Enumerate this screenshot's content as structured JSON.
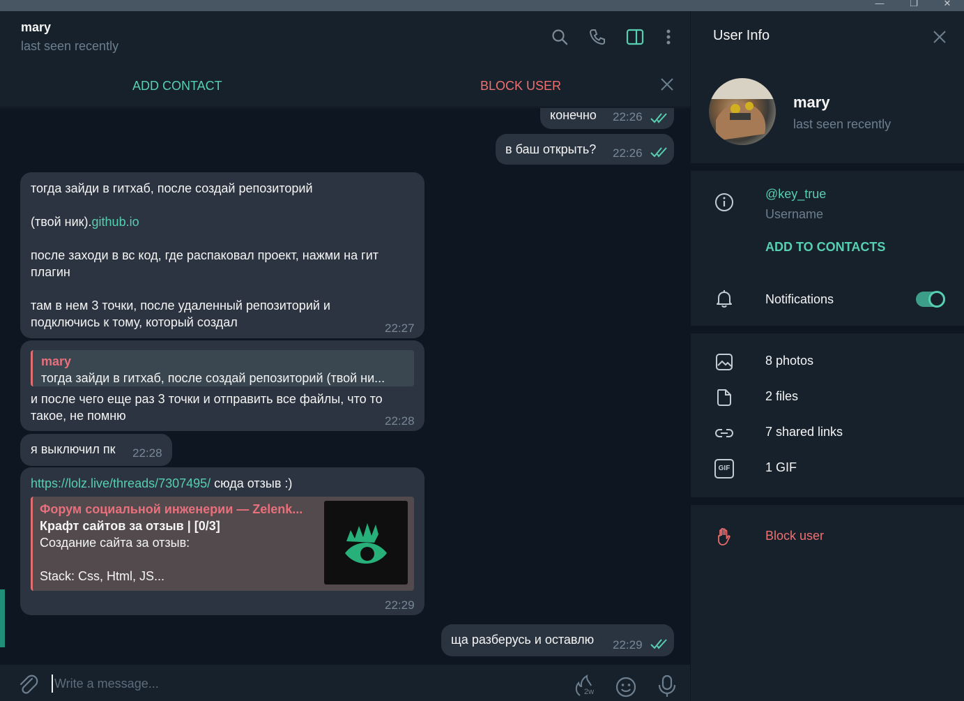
{
  "window": {
    "minimize_glyph": "—",
    "maximize_glyph": "❐",
    "close_glyph": "✕"
  },
  "header": {
    "name": "mary",
    "status": "last seen recently"
  },
  "action_bar": {
    "add_contact": "ADD CONTACT",
    "block_user": "BLOCK USER"
  },
  "messages": [
    {
      "text": "конечно",
      "time": "22:26"
    },
    {
      "text": "в баш открыть?",
      "time": "22:26"
    },
    {
      "line1": "тогда зайди в гитхаб, после создай репозиторий",
      "line2_prefix": "(твой ник).",
      "line2_link": "github.io",
      "line3": "после заходи в вс код, где распаковал проект, нажми на гит",
      "line3b": "плагин",
      "line4": "там в нем 3 точки, после удаленный репозиторий и",
      "line4b": "подключись к тому, который создал",
      "time": "22:27"
    },
    {
      "reply_name": "mary",
      "reply_text": "тогда зайди в гитхаб, после создай репозиторий   (твой ни...",
      "line1": "и после чего еще раз 3 точки и отправить все файлы, что то",
      "line2": "такое, не помню",
      "time": "22:28"
    },
    {
      "text": "я выключил пк",
      "time": "22:28"
    },
    {
      "link": "https://lolz.live/threads/7307495/",
      "text": " сюда отзыв :)",
      "preview_site": "Форум социальной инженерии — Zelenk...",
      "preview_title": "Крафт сайтов за отзыв | [0/3]",
      "preview_desc1": "Создание сайта за отзыв:",
      "preview_desc2": "Stack: Css, Html, JS...",
      "time": "22:29"
    },
    {
      "text": "ща разберусь и оставлю",
      "time": "22:29"
    }
  ],
  "composer": {
    "placeholder": "Write a message...",
    "timer_label": "2w"
  },
  "panel": {
    "title": "User Info",
    "name": "mary",
    "status": "last seen recently",
    "username": "@key_true",
    "username_label": "Username",
    "add_to_contacts": "ADD TO CONTACTS",
    "notifications": "Notifications",
    "notifications_on": true,
    "photos": "8 photos",
    "files": "2 files",
    "links": "7 shared links",
    "gifs": "1 GIF",
    "gif_badge": "GIF",
    "block": "Block user"
  },
  "colors": {
    "accent": "#57cfb1",
    "danger": "#f07070",
    "bg": "#17212b",
    "chat_bg": "#0e1621"
  }
}
